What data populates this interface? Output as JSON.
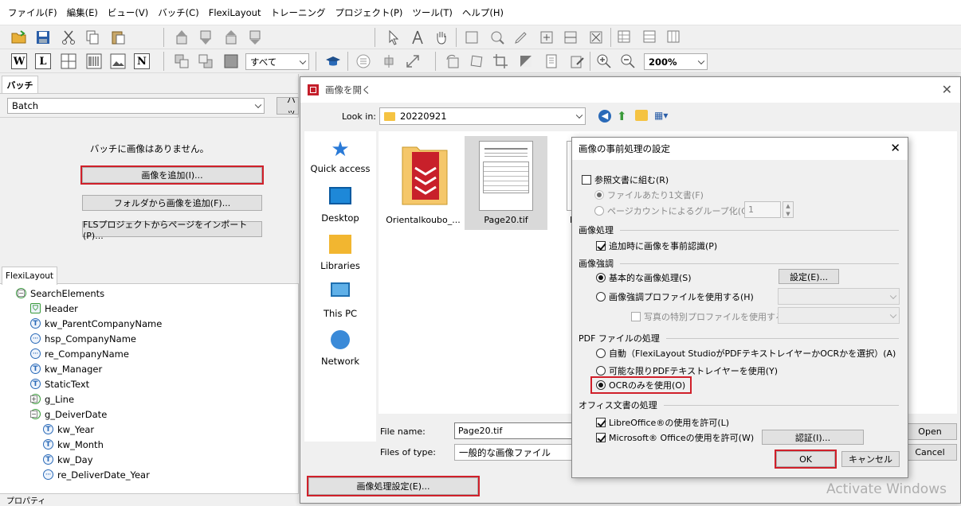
{
  "menu": [
    "ファイル(F)",
    "編集(E)",
    "ビュー(V)",
    "バッチ(C)",
    "FlexiLayout",
    "トレーニング",
    "プロジェクト(P)",
    "ツール(T)",
    "ヘルプ(H)"
  ],
  "toolbar": {
    "block_type": "すべて",
    "zoom": "200%",
    "letters": [
      "W",
      "L",
      "N"
    ]
  },
  "batch_panel": {
    "tab": "バッチ",
    "batch_select": "Batch",
    "clipped_button": "バッ",
    "empty_message": "バッチに画像はありません。",
    "add_images": "画像を追加(I)...",
    "add_folder": "フォルダから画像を追加(F)...",
    "import_fls": "FLSプロジェクトからページをインポート(P)..."
  },
  "flexi_panel": {
    "tab": "FlexiLayout",
    "tree": [
      {
        "label": "SearchElements",
        "icon": "search-elements-icon",
        "indent": 0
      },
      {
        "label": "Header",
        "icon": "header-icon",
        "indent": 1
      },
      {
        "label": "kw_ParentCompanyName",
        "icon": "T",
        "indent": 1
      },
      {
        "label": "hsp_CompanyName",
        "icon": "·",
        "indent": 1
      },
      {
        "label": "re_CompanyName",
        "icon": "·",
        "indent": 1
      },
      {
        "label": "kw_Manager",
        "icon": "T",
        "indent": 1
      },
      {
        "label": "StaticText",
        "icon": "T",
        "indent": 1
      },
      {
        "label": "g_Line",
        "icon": "group-icon",
        "indent": 1
      },
      {
        "label": "g_DeiverDate",
        "icon": "group-icon",
        "indent": 1
      },
      {
        "label": "kw_Year",
        "icon": "T",
        "indent": 2
      },
      {
        "label": "kw_Month",
        "icon": "T",
        "indent": 2
      },
      {
        "label": "kw_Day",
        "icon": "T",
        "indent": 2
      },
      {
        "label": "re_DeliverDate_Year",
        "icon": "·",
        "indent": 2
      }
    ],
    "bottom_tab": "プロパティ"
  },
  "open_dialog": {
    "title": "画像を開く",
    "look_in_label": "Look in:",
    "look_in_value": "20220921",
    "places": [
      "Quick access",
      "Desktop",
      "Libraries",
      "This PC",
      "Network"
    ],
    "files": [
      {
        "name": "Orientalkoubo_...",
        "kind": "folder"
      },
      {
        "name": "Page20.tif",
        "kind": "tif"
      },
      {
        "name": "P",
        "kind": "tif"
      }
    ],
    "file_name_label": "File name:",
    "file_name_value": "Page20.tif",
    "file_type_label": "Files of type:",
    "file_type_value": "一般的な画像ファイル",
    "open": "Open",
    "cancel": "Cancel",
    "preprocess_button": "画像処理設定(E)..."
  },
  "pre_dialog": {
    "title": "画像の事前処理の設定",
    "ref_doc": "参照文書に組む(R)",
    "one_per_file": "ファイルあたり1文書(F)",
    "group_by_count": "ページカウントによるグループ化(G):",
    "group_count": "1",
    "image_processing": "画像処理",
    "preprocess_on_add": "追加時に画像を事前認識(P)",
    "enhancement": "画像強調",
    "basic": "基本的な画像処理(S)",
    "settings_button": "設定(E)...",
    "use_profile": "画像強調プロファイルを使用する(H)",
    "photo_profile": "写真の特別プロファイルを使用する(U)",
    "pdf_processing": "PDF ファイルの処理",
    "pdf_auto": "自動（FlexiLayout StudioがPDFテキストレイヤーかOCRかを選択）(A)",
    "pdf_text_layer": "可能な限りPDFテキストレイヤーを使用(Y)",
    "pdf_ocr_only": "OCRのみを使用(O)",
    "office_processing": "オフィス文書の処理",
    "libreoffice": "LibreOffice®の使用を許可(L)",
    "msoffice": "Microsoft® Officeの使用を許可(W)",
    "auth_button": "認証(I)...",
    "ok": "OK",
    "cancel": "キャンセル"
  },
  "watermark": "Activate Windows",
  "colors": {
    "highlight": "#d0202a",
    "accent": "#0078d7"
  }
}
